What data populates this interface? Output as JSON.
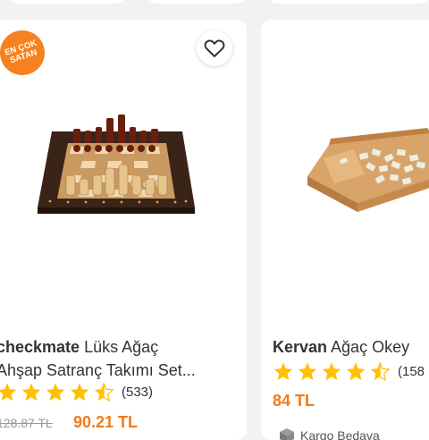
{
  "colors": {
    "accent": "#f27a1a",
    "star": "#ffc000",
    "badge": "#f5811f"
  },
  "left_product": {
    "badge_line1": "EN ÇOK",
    "badge_line2": "SATAN",
    "brand": "checkmate",
    "title_line1_rest": " Lüks Ağaç",
    "title_line2": "Ahşap Satranç Takımı Set...",
    "rating": 4.5,
    "review_count": "(533)",
    "old_price": "128.87 TL",
    "price": "90.21 TL",
    "favorite_icon": "heart-outline-icon"
  },
  "right_product": {
    "brand": "Kervan",
    "title_rest": " Ağaç Okey",
    "rating": 4.5,
    "review_count": "(158",
    "price": "84 TL",
    "cargo_label": "Kargo Bedava",
    "cargo_icon": "box-icon"
  }
}
